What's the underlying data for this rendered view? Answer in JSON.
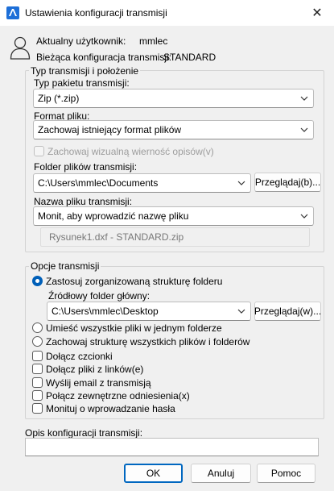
{
  "window": {
    "title": "Ustawienia konfiguracji transmisji"
  },
  "info": {
    "user_label": "Aktualny użytkownik:",
    "user_value": "mmlec",
    "config_label": "Bieżąca konfiguracja transmisji:",
    "config_value": "STANDARD"
  },
  "type_group": {
    "title": "Typ transmisji i położenie",
    "package_label": "Typ pakietu transmisji:",
    "package_value": "Zip (*.zip)",
    "format_label": "Format pliku:",
    "format_value": "Zachowaj istniejący format plików",
    "visual_fidelity_label": "Zachowaj wizualną wierność opisów(v)",
    "folder_label": "Folder plików transmisji:",
    "folder_value": "C:\\Users\\mmlec\\Documents",
    "browse1_label": "Przeglądaj(b)...",
    "filename_label": "Nazwa pliku transmisji:",
    "filename_value": "Monit, aby wprowadzić nazwę pliku",
    "preview_value": "Rysunek1.dxf - STANDARD.zip"
  },
  "options_group": {
    "title": "Opcje transmisji",
    "organized_label": "Zastosuj zorganizowaną strukturę folderu",
    "source_root_label": "Źródłowy folder główny:",
    "source_root_value": "C:\\Users\\mmlec\\Desktop",
    "browse2_label": "Przeglądaj(w)...",
    "single_folder_label": "Umieść wszystkie pliki w jednym folderze",
    "keep_structure_label": "Zachowaj strukturę wszystkich plików i folderów",
    "include_fonts_label": "Dołącz czcionki",
    "include_linked_label": "Dołącz pliki z linków(e)",
    "send_email_label": "Wyślij email z transmisją",
    "bind_xrefs_label": "Połącz zewnętrzne odniesienia(x)",
    "prompt_password_label": "Monituj o wprowadzanie hasła"
  },
  "description": {
    "label": "Opis konfiguracji transmisji:",
    "value": ""
  },
  "buttons": {
    "ok": "OK",
    "cancel": "Anuluj",
    "help": "Pomoc"
  },
  "colors": {
    "accent": "#005fb8",
    "background": "#f0f0f0"
  },
  "icons": {
    "app": "autocad-icon",
    "user": "user-icon",
    "close": "close-icon",
    "dropdown": "chevron-down-icon"
  }
}
